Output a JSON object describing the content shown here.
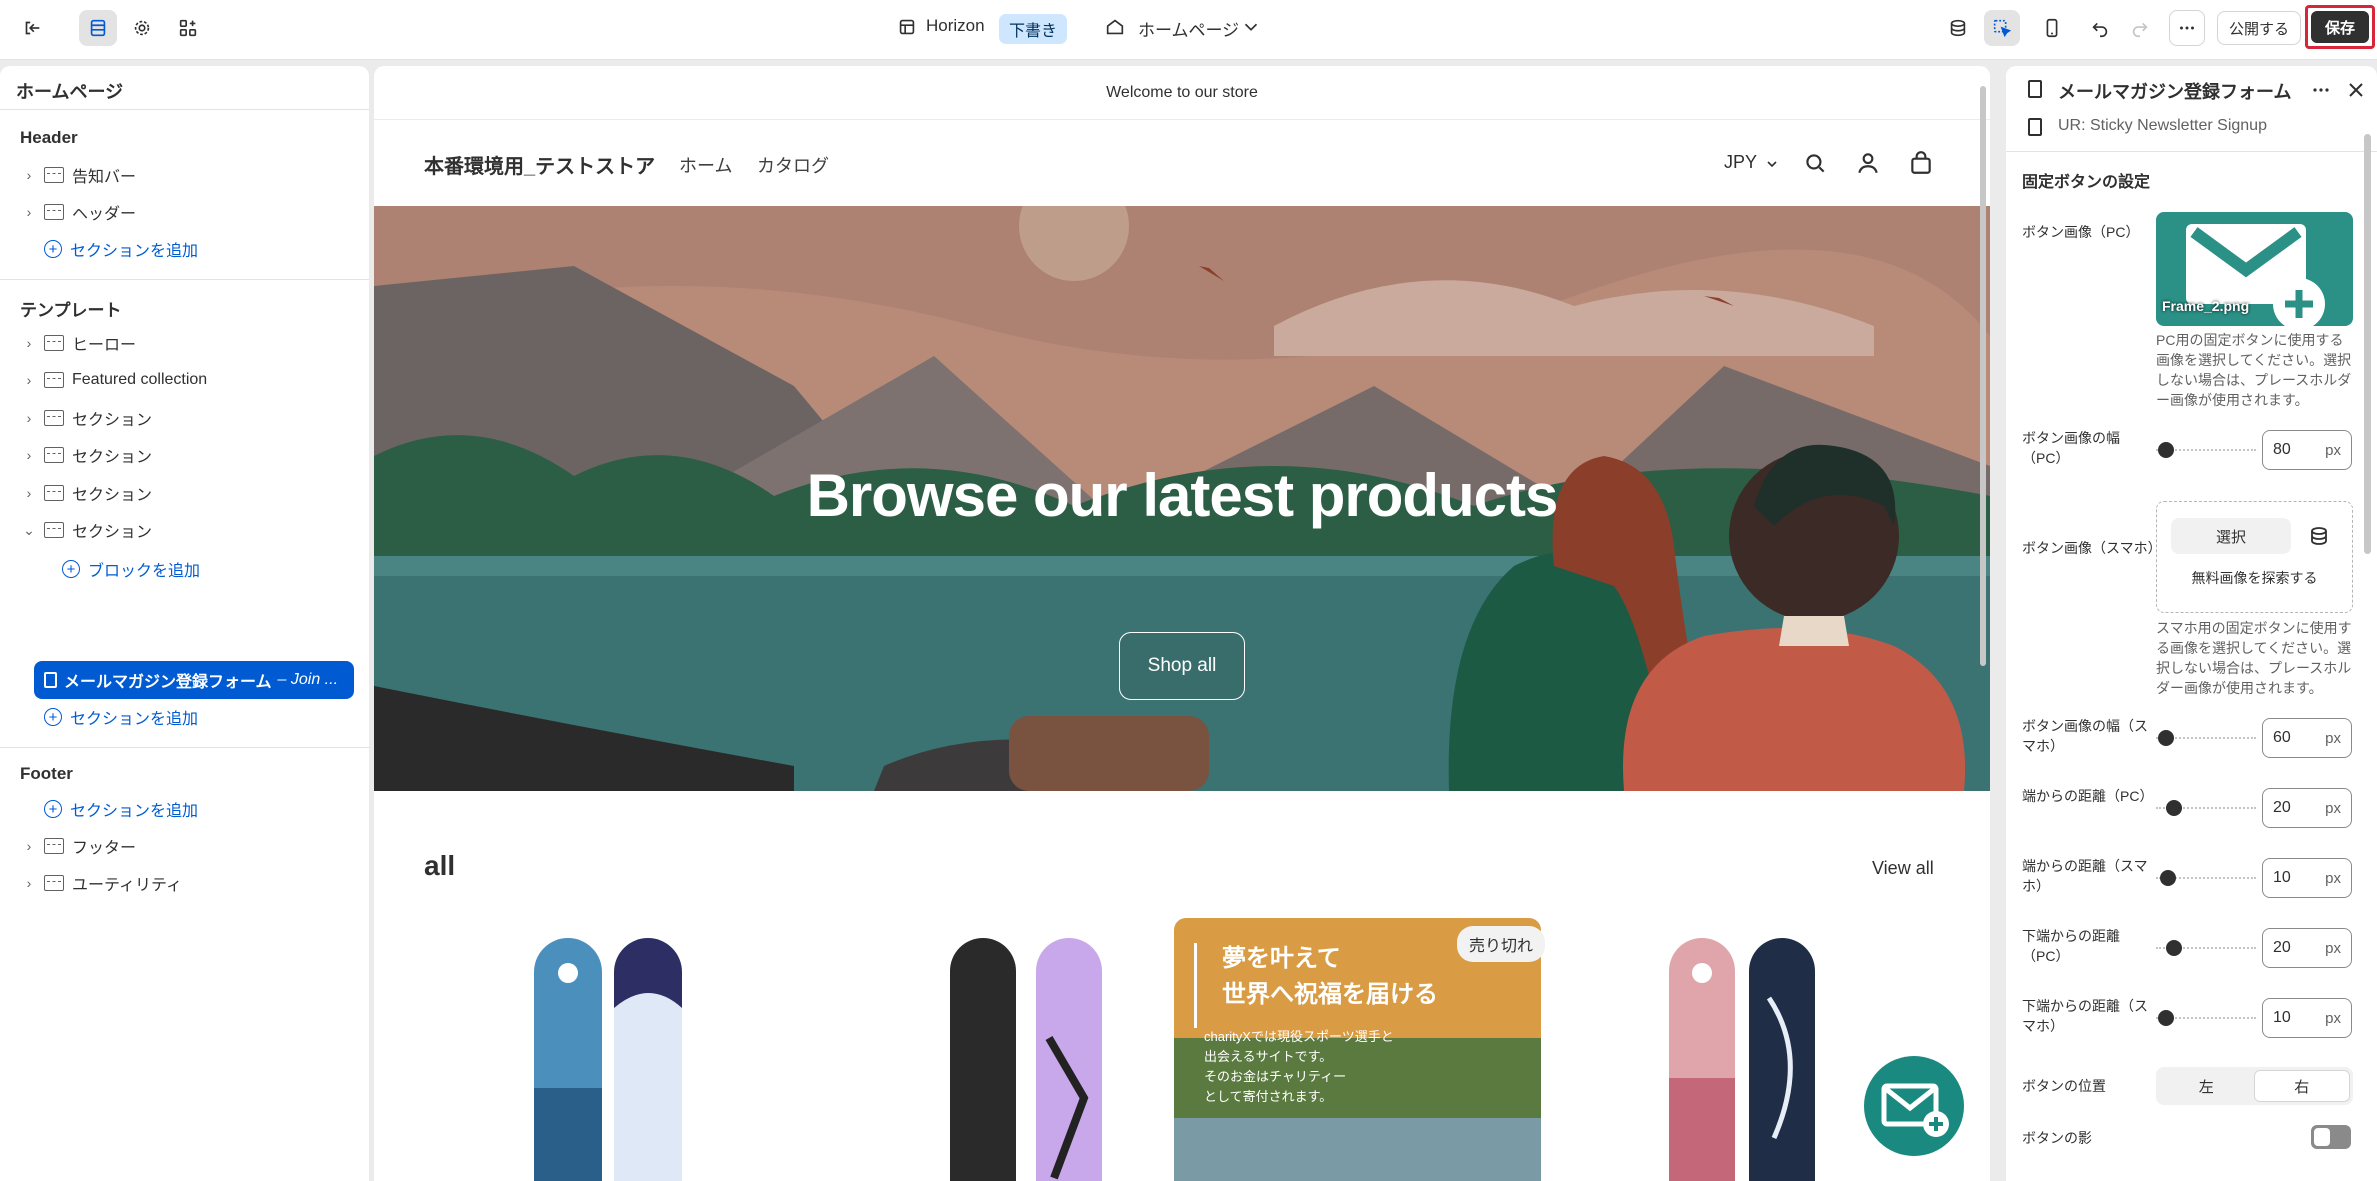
{
  "topbar": {
    "theme_name": "Horizon",
    "draft_badge": "下書き",
    "page_select": "ホームページ",
    "publish_label": "公開する",
    "save_label": "保存"
  },
  "left_panel": {
    "title": "ホームページ",
    "header_group": {
      "title": "Header",
      "items": [
        "告知バー",
        "ヘッダー"
      ],
      "add_label": "セクションを追加"
    },
    "template_group": {
      "title": "テンプレート",
      "items": [
        "ヒーロー",
        "Featured collection",
        "セクション",
        "セクション",
        "セクション",
        "セクション"
      ],
      "add_block_label": "ブロックを追加",
      "selected_block": "メールマガジン登録フォーム",
      "selected_block_note": "– Join ...",
      "add_label": "セクションを追加"
    },
    "footer_group": {
      "title": "Footer",
      "add_label": "セクションを追加",
      "items": [
        "フッター",
        "ユーティリティ"
      ]
    }
  },
  "preview": {
    "announcement": "Welcome to our store",
    "store_name": "本番環境用_テストストア",
    "nav": [
      "ホーム",
      "カタログ"
    ],
    "currency": "JPY",
    "hero_title": "Browse our latest products",
    "hero_button": "Shop all",
    "collection_title": "all",
    "view_all": "View all",
    "sold_out_badge": "売り切れ",
    "promo_heading_1": "夢を叶えて",
    "promo_heading_2": "世界へ祝福を届ける",
    "promo_body": [
      "charityXでは現役スポーツ選手と",
      "出会えるサイトです。",
      "そのお金はチャリティー",
      "として寄付されます。"
    ]
  },
  "right_panel": {
    "title": "メールマガジン登録フォーム",
    "subtitle": "UR: Sticky Newsletter Signup",
    "section_title": "固定ボタンの設定",
    "image_pc_label": "ボタン画像（PC）",
    "image_pc_filename": "Frame_2.png",
    "image_pc_help": "PC用の固定ボタンに使用する画像を選択してください。選択しない場合は、プレースホルダー画像が使用されます。",
    "width_pc_label": "ボタン画像の幅（PC）",
    "width_pc_value": "80",
    "image_sp_label": "ボタン画像（スマホ）",
    "select_label": "選択",
    "free_images_label": "無料画像を探索する",
    "image_sp_help": "スマホ用の固定ボタンに使用する画像を選択してください。選択しない場合は、プレースホルダー画像が使用されます。",
    "width_sp_label": "ボタン画像の幅（スマホ）",
    "width_sp_value": "60",
    "edge_pc_label": "端からの距離（PC）",
    "edge_pc_value": "20",
    "edge_sp_label": "端からの距離（スマホ）",
    "edge_sp_value": "10",
    "bottom_pc_label": "下端からの距離（PC）",
    "bottom_pc_value": "20",
    "bottom_sp_label": "下端からの距離（スマホ）",
    "bottom_sp_value": "10",
    "unit": "px",
    "position_label": "ボタンの位置",
    "position_left": "左",
    "position_right": "右",
    "shadow_label": "ボタンの影"
  },
  "colors": {
    "accent": "#005bd3",
    "save_bg": "#303030",
    "highlight_border": "#d7263a",
    "teal": "#2b9187"
  }
}
